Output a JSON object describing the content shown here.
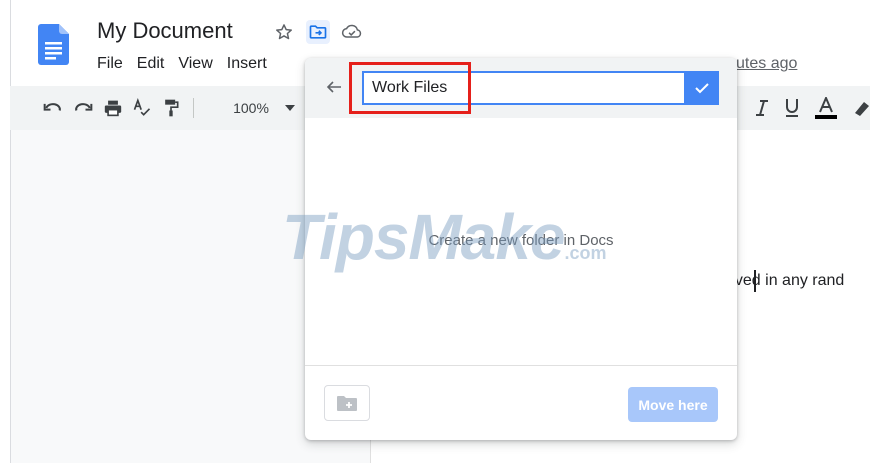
{
  "document": {
    "title": "My Document",
    "last_edit": "utes ago",
    "body_fragment": "aved in any rand"
  },
  "menubar": [
    "File",
    "Edit",
    "View",
    "Insert"
  ],
  "toolbar": {
    "zoom": "100%"
  },
  "dialog": {
    "folder_name_value": "Work Files",
    "empty_message": "Create a new folder in Docs",
    "move_label": "Move here"
  },
  "watermark": {
    "brand": "TipsMake",
    "suffix": ".com"
  },
  "colors": {
    "docs_blue": "#4285f4",
    "highlight_red": "#e5201b",
    "move_disabled": "#a8c7fa",
    "toolbar_bg": "#f1f3f4"
  },
  "icons": {
    "logo": "google-docs-icon",
    "star": "star-icon",
    "move": "move-to-folder-icon",
    "cloud": "cloud-saved-icon",
    "undo": "undo-icon",
    "redo": "redo-icon",
    "print": "print-icon",
    "spellcheck": "spellcheck-icon",
    "paint_format": "paint-format-icon",
    "italic": "italic-icon",
    "underline": "underline-icon",
    "text_color": "text-color-icon",
    "highlight": "highlight-pen-icon",
    "back": "back-arrow-icon",
    "check": "check-icon",
    "new_folder": "new-folder-icon"
  }
}
